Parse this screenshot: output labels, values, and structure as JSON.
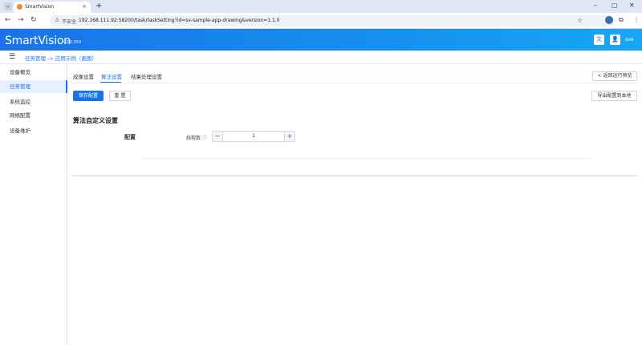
{
  "browser": {
    "tab_title": "SmartVision",
    "tab_close": "×",
    "new_tab": "+",
    "insecure_label": "不安全",
    "url": "192.168.111.92:58200/task/taskSetting?id=sv-sample-app-drawing&version=1.1.0"
  },
  "header": {
    "logo": "SmartVision",
    "version": "v2.0.350",
    "user": "sve"
  },
  "breadcrumb": "任务管理 -> 应用示例（画图）",
  "sidebar": {
    "items": [
      {
        "label": "设备概览"
      },
      {
        "label": "任务管理"
      },
      {
        "label": "系统监控"
      },
      {
        "label": "网络配置"
      },
      {
        "label": "设备维护"
      }
    ]
  },
  "tabs": [
    {
      "label": "成像设置"
    },
    {
      "label": "算法设置"
    },
    {
      "label": "结果处理设置"
    }
  ],
  "back_button": "< 返回运行预览",
  "actions": {
    "save": "保存配置",
    "reset": "重 置",
    "export": "导出配置到本地"
  },
  "section": {
    "title": "算法自定义设置",
    "config_label": "配置",
    "threads_label": "线程数",
    "threads_value": "1"
  },
  "colors": {
    "accent": "#1a73e8",
    "header_end": "#17a7f3"
  }
}
